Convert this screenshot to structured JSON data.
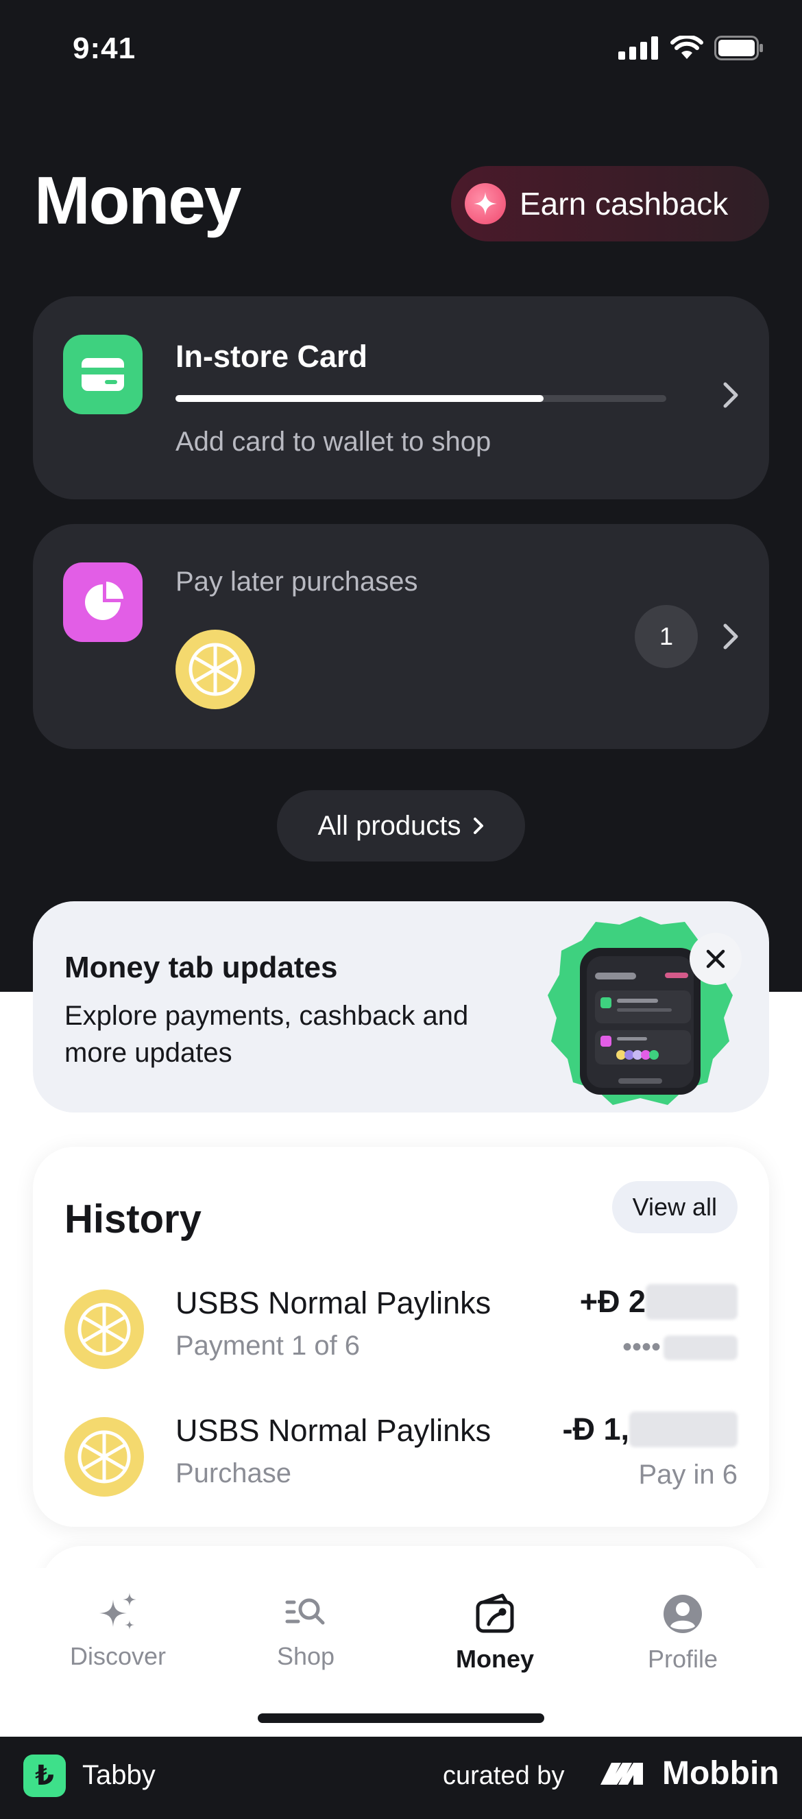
{
  "status_bar": {
    "time": "9:41"
  },
  "header": {
    "title": "Money",
    "earn_button": "Earn cashback"
  },
  "instore_card": {
    "title": "In-store Card",
    "subtitle": "Add card to wallet to shop",
    "progress": 0.75,
    "icon": "card-icon",
    "icon_color": "#3ed17f"
  },
  "paylater_card": {
    "title": "Pay later purchases",
    "count": "1",
    "icon": "pie-chart-icon",
    "icon_color": "#e25ee6"
  },
  "all_products": "All products",
  "updates": {
    "title": "Money tab updates",
    "text": "Explore payments, cashback and more updates"
  },
  "history": {
    "title": "History",
    "view_all": "View all",
    "items": [
      {
        "name": "USBS Normal Paylinks",
        "sub": "Payment 1 of 6",
        "amount_prefix": "+Đ 2",
        "note": "••••"
      },
      {
        "name": "USBS Normal Paylinks",
        "sub": "Purchase",
        "amount_prefix": "-Đ 1,",
        "note": "Pay in 6"
      }
    ]
  },
  "tabs": [
    {
      "label": "Discover",
      "icon": "sparkles-icon"
    },
    {
      "label": "Shop",
      "icon": "search-list-icon"
    },
    {
      "label": "Money",
      "icon": "wallet-icon",
      "active": true
    },
    {
      "label": "Profile",
      "icon": "profile-icon"
    }
  ],
  "footer": {
    "app_name": "Tabby",
    "curated_by": "curated by",
    "brand": "Mobbin"
  },
  "colors": {
    "dark_bg": "#16171b",
    "card_dark": "#28292f",
    "lemon": "#f4d96e",
    "green": "#3ed17f",
    "pink": "#e25ee6"
  }
}
